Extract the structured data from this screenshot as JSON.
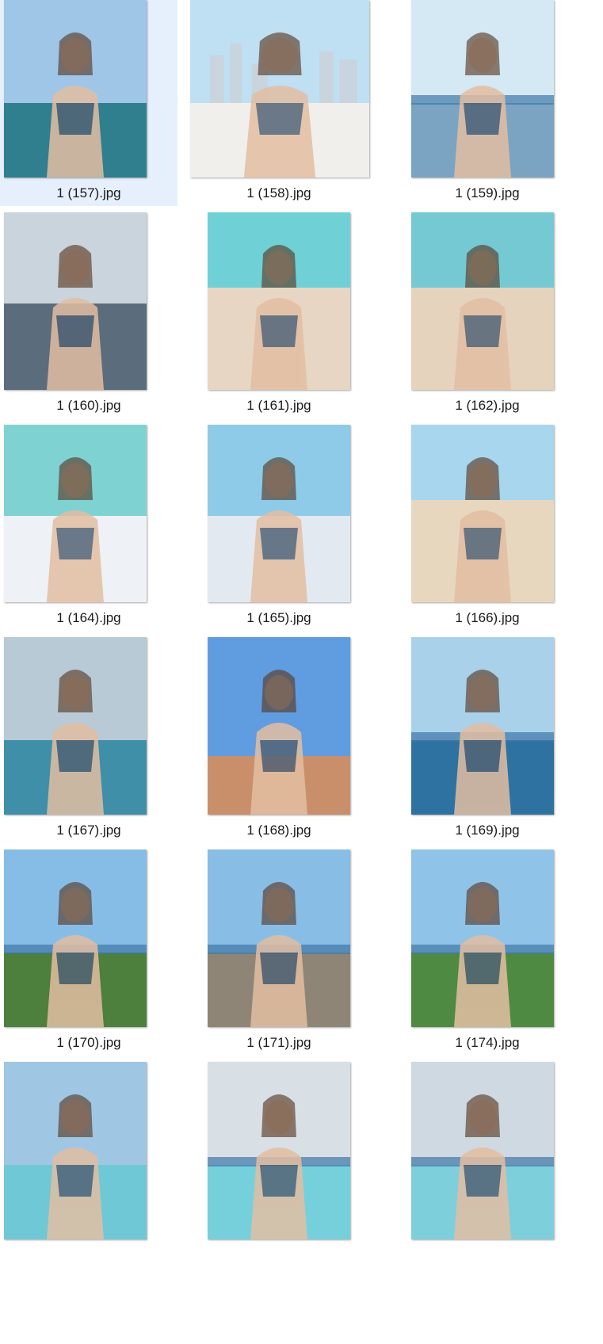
{
  "files": [
    {
      "name": "1 (157).jpg",
      "selected": true,
      "sky": "#9fc6e6",
      "ground": "#2f7f8f",
      "scene": "pool"
    },
    {
      "name": "1 (158).jpg",
      "selected": false,
      "sky": "#bfe0f2",
      "ground": "#f1efec",
      "scene": "city"
    },
    {
      "name": "1 (159).jpg",
      "selected": false,
      "sky": "#d5e9f4",
      "ground": "#7aa4c2",
      "scene": "sea"
    },
    {
      "name": "1 (160).jpg",
      "selected": false,
      "sky": "#c9d4dc",
      "ground": "#5b6c7d",
      "scene": "window"
    },
    {
      "name": "1 (161).jpg",
      "selected": false,
      "sky": "#6fd0d6",
      "ground": "#e7d6c3",
      "scene": "beach"
    },
    {
      "name": "1 (162).jpg",
      "selected": false,
      "sky": "#74c9d3",
      "ground": "#e6d3bd",
      "scene": "beach"
    },
    {
      "name": "1 (164).jpg",
      "selected": false,
      "sky": "#7fd2d2",
      "ground": "#eef1f5",
      "scene": "bed"
    },
    {
      "name": "1 (165).jpg",
      "selected": false,
      "sky": "#8dcbe8",
      "ground": "#e3e9f0",
      "scene": "bed"
    },
    {
      "name": "1 (166).jpg",
      "selected": false,
      "sky": "#a7d6ee",
      "ground": "#e8d7bf",
      "scene": "beach"
    },
    {
      "name": "1 (167).jpg",
      "selected": false,
      "sky": "#b8cad6",
      "ground": "#3e8fa7",
      "scene": "pool"
    },
    {
      "name": "1 (168).jpg",
      "selected": false,
      "sky": "#5f9de0",
      "ground": "#c98f6b",
      "scene": "street"
    },
    {
      "name": "1 (169).jpg",
      "selected": false,
      "sky": "#a9d1ea",
      "ground": "#2d72a0",
      "scene": "sea"
    },
    {
      "name": "1 (170).jpg",
      "selected": false,
      "sky": "#86bde6",
      "ground": "#4d7f3d",
      "scene": "cliff"
    },
    {
      "name": "1 (171).jpg",
      "selected": false,
      "sky": "#88bde6",
      "ground": "#8f8576",
      "scene": "cliff"
    },
    {
      "name": "1 (174).jpg",
      "selected": false,
      "sky": "#8fc3e8",
      "ground": "#4f8a43",
      "scene": "cliff"
    },
    {
      "name": "",
      "selected": false,
      "sky": "#9fc7e4",
      "ground": "#6fc8d6",
      "scene": "dining"
    },
    {
      "name": "",
      "selected": false,
      "sky": "#d8e0e6",
      "ground": "#76d0dc",
      "scene": "infinity"
    },
    {
      "name": "",
      "selected": false,
      "sky": "#cfd9e2",
      "ground": "#7ecfdc",
      "scene": "infinity"
    }
  ]
}
